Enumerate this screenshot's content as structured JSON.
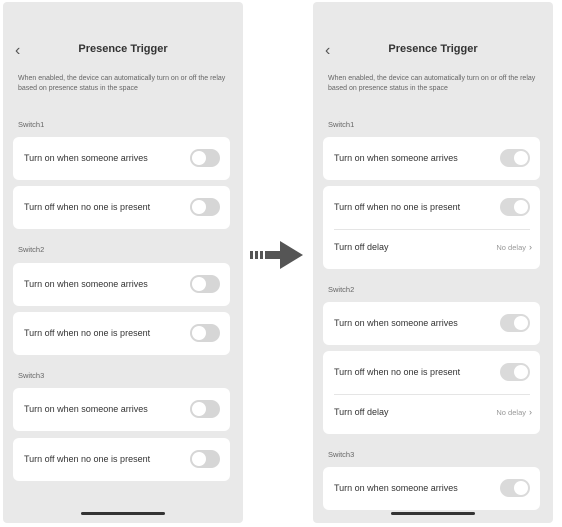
{
  "left": {
    "title": "Presence Trigger",
    "description": "When enabled, the device can automatically turn on or off the relay based on presence status in the space",
    "sections": [
      {
        "name": "Switch1",
        "rows": [
          "Turn on when someone arrives",
          "Turn off when no one is present"
        ]
      },
      {
        "name": "Switch2",
        "rows": [
          "Turn on when someone arrives",
          "Turn off when no one is present"
        ]
      },
      {
        "name": "Switch3",
        "rows": [
          "Turn on when someone arrives",
          "Turn off when no one is present"
        ]
      }
    ],
    "toggles_on": false
  },
  "right": {
    "title": "Presence Trigger",
    "description": "When enabled, the device can automatically turn on or off the relay based on presence status in the space",
    "sections": [
      {
        "name": "Switch1",
        "on_label": "Turn on when someone arrives",
        "off_label": "Turn off when no one is present",
        "delay_label": "Turn off delay",
        "delay_value": "No delay"
      },
      {
        "name": "Switch2",
        "on_label": "Turn on when someone arrives",
        "off_label": "Turn off when no one is present",
        "delay_label": "Turn off delay",
        "delay_value": "No delay"
      },
      {
        "name": "Switch3",
        "on_label": "Turn on when someone arrives"
      }
    ],
    "toggles_on": true
  },
  "icons": {
    "back": "chevron-left-icon",
    "transition": "arrow-right-icon",
    "chevron": "chevron-right-icon"
  },
  "colors": {
    "phone_bg": "#e9e9e9",
    "card_bg": "#ffffff",
    "toggle_off": "#d6d6d6",
    "arrow": "#555555"
  }
}
